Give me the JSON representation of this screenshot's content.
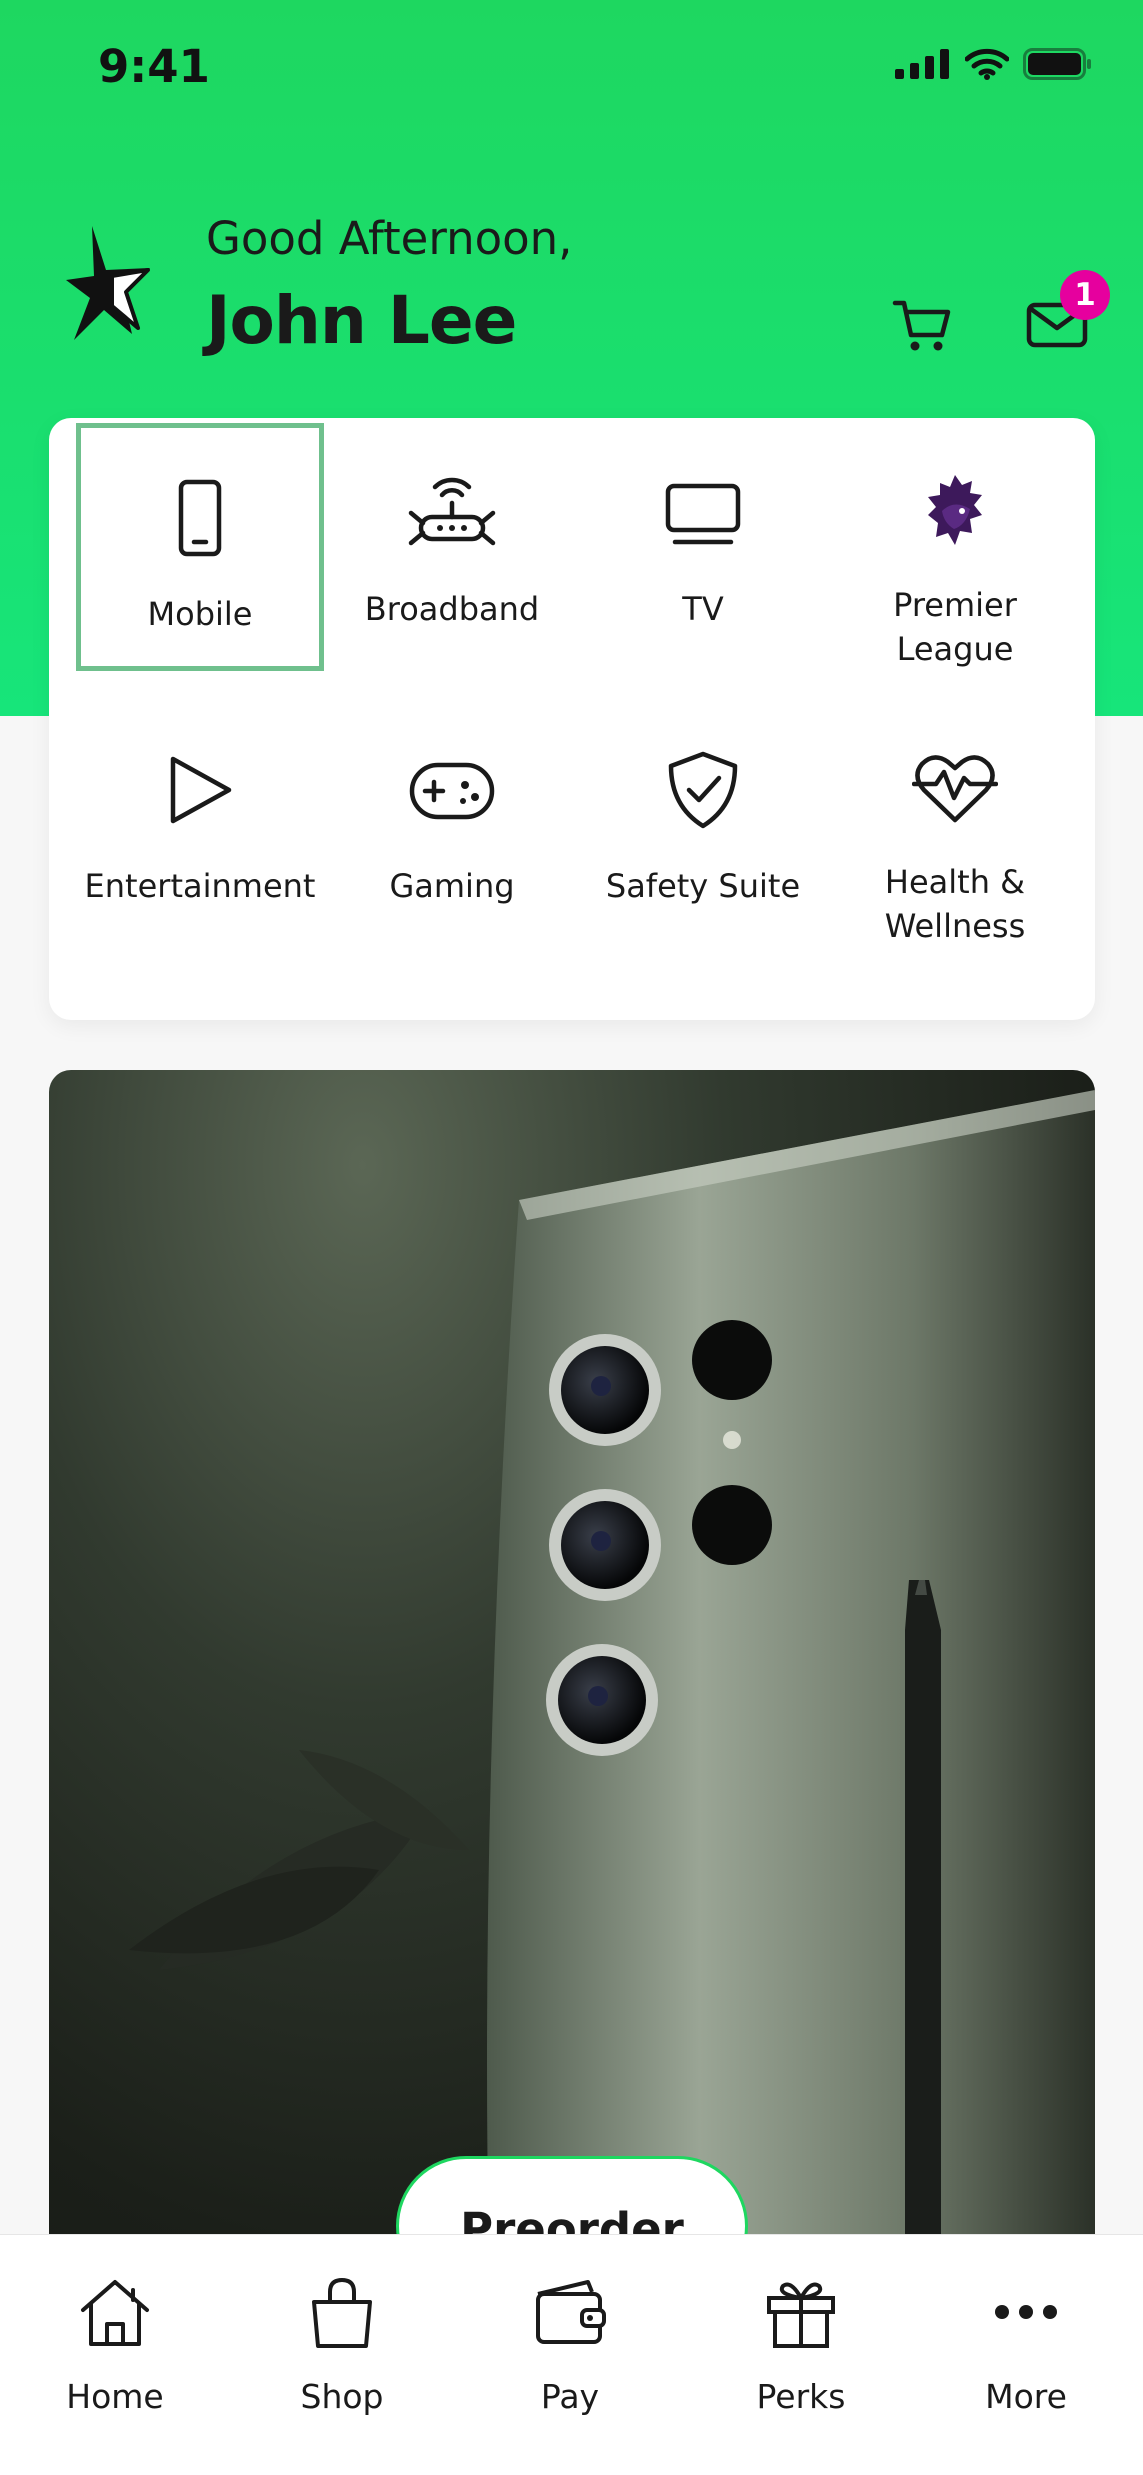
{
  "status_bar": {
    "time": "9:41"
  },
  "header": {
    "greeting": "Good Afternoon,",
    "user_name": "John Lee",
    "mail_badge_count": "1"
  },
  "services": [
    {
      "label": "Mobile",
      "icon": "mobile-phone-icon",
      "selected": true
    },
    {
      "label": "Broadband",
      "icon": "router-icon"
    },
    {
      "label": "TV",
      "icon": "tv-icon"
    },
    {
      "label": "Premier\nLeague",
      "icon": "premier-league-lion-icon"
    },
    {
      "label": "Entertainment",
      "icon": "play-icon"
    },
    {
      "label": "Gaming",
      "icon": "gamepad-icon"
    },
    {
      "label": "Safety Suite",
      "icon": "shield-check-icon"
    },
    {
      "label": "Health &\nWellness",
      "icon": "heart-pulse-icon"
    }
  ],
  "promo": {
    "button_label": "Preorder"
  },
  "tab_bar": [
    {
      "label": "Home",
      "icon": "home-icon"
    },
    {
      "label": "Shop",
      "icon": "shopping-bag-icon"
    },
    {
      "label": "Pay",
      "icon": "wallet-icon"
    },
    {
      "label": "Perks",
      "icon": "gift-icon"
    },
    {
      "label": "More",
      "icon": "more-dots-icon"
    }
  ],
  "colors": {
    "brand_green": "#1ed760",
    "badge_magenta": "#e6009e",
    "premier_league_purple": "#3d195b",
    "selection_border": "#6fc08d"
  }
}
